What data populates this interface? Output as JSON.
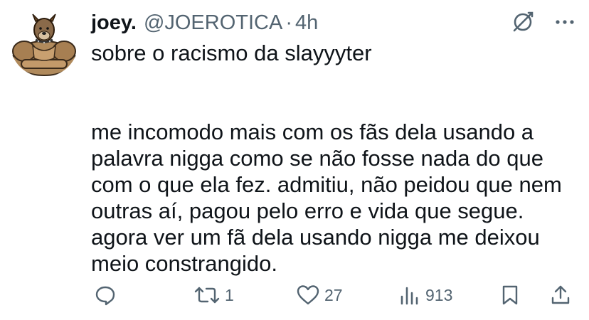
{
  "tweet": {
    "author": {
      "display_name": "joey.",
      "handle": "@JOEROTICA",
      "separator": "·",
      "timestamp": "4h",
      "avatar_icon": "muscular-pitbull-avatar"
    },
    "text_lines": [
      "sobre o racismo da slayyyter",
      "me incomodo mais com os fãs dela usando a",
      "palavra nigga como se não fosse nada do que",
      "com o que ela fez. admitiu, não peidou que nem",
      "outras aí, pagou pelo erro e vida que segue.",
      "agora ver um fã dela usando nigga me deixou",
      "meio constrangido."
    ],
    "actions": {
      "reply": {
        "icon": "reply-icon",
        "count": ""
      },
      "retweet": {
        "icon": "retweet-icon",
        "count": "1"
      },
      "like": {
        "icon": "heart-icon",
        "count": "27"
      },
      "views": {
        "icon": "views-icon",
        "count": "913"
      },
      "bookmark": {
        "icon": "bookmark-icon"
      },
      "share": {
        "icon": "share-icon"
      }
    },
    "top_icons": [
      "grok-icon",
      "more-icon"
    ]
  },
  "colors": {
    "text": "#0f1419",
    "secondary": "#536471",
    "background": "#ffffff"
  }
}
